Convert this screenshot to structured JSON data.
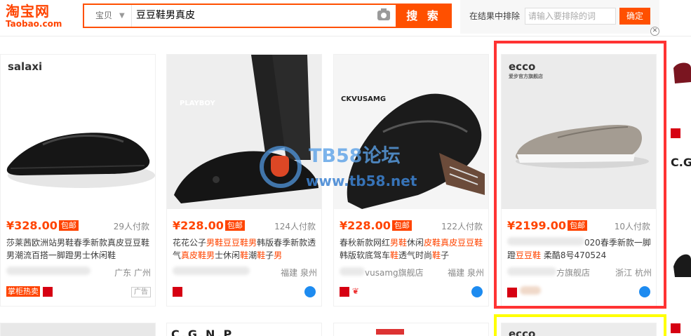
{
  "logo": {
    "cn": "淘宝网",
    "en": "Taobao.com"
  },
  "search": {
    "scope": "宝贝",
    "query": "豆豆鞋男真皮",
    "button": "搜 索"
  },
  "exclude": {
    "label": "在结果中排除",
    "placeholder": "请输入要排除的词",
    "button": "确定"
  },
  "products": [
    {
      "brand": "salaxi",
      "price": "¥328.00",
      "badge": "包邮",
      "sold": "29人付款",
      "title": "莎莱茜欧洲站男鞋春季新款真皮豆豆鞋男潮流百搭一脚蹬男士休闲鞋",
      "location": "广东 广州",
      "promo": "掌柜热卖",
      "ad": "广告"
    },
    {
      "brand": "PLAYBOY",
      "price": "¥228.00",
      "badge": "包邮",
      "sold": "124人付款",
      "title_parts": [
        "花花公子",
        "男鞋",
        "豆豆鞋",
        "男",
        "韩版春季新款透气",
        "真皮鞋",
        "男",
        "士休闲",
        "鞋",
        "潮",
        "鞋",
        "子",
        "男"
      ],
      "location": "福建 泉州"
    },
    {
      "brand": "CKVUSAMG",
      "price": "¥228.00",
      "badge": "包邮",
      "sold": "122人付款",
      "title_parts": [
        "春秋新款网红",
        "男鞋",
        "休闲",
        "皮鞋",
        "真皮豆豆",
        "鞋",
        "韩版软底驾车",
        "鞋",
        "透气时尚",
        "鞋",
        "子"
      ],
      "shop": "vusamg旗舰店",
      "location": "福建 泉州"
    },
    {
      "brand": "ecco",
      "brand_sub": "爱步官方旗舰店",
      "price": "¥2199.00",
      "badge": "包邮",
      "sold": "10人付款",
      "title_parts": [
        "020春季新款一脚蹬",
        "豆豆鞋",
        " 柔酷8号470524"
      ],
      "shop": "方旗舰店",
      "location": "浙江 杭州"
    }
  ],
  "row2": {
    "brand_a": "C.G.N.P",
    "brand_b": "ecco"
  },
  "edge": {
    "brand": "C.G"
  },
  "watermark": {
    "text": "TB58论坛",
    "url": "www.tb58.net"
  },
  "colors": {
    "accent": "#ff5000",
    "price": "#ff4400",
    "highlight_red": "#ff3333",
    "highlight_yellow": "#ffff00"
  }
}
